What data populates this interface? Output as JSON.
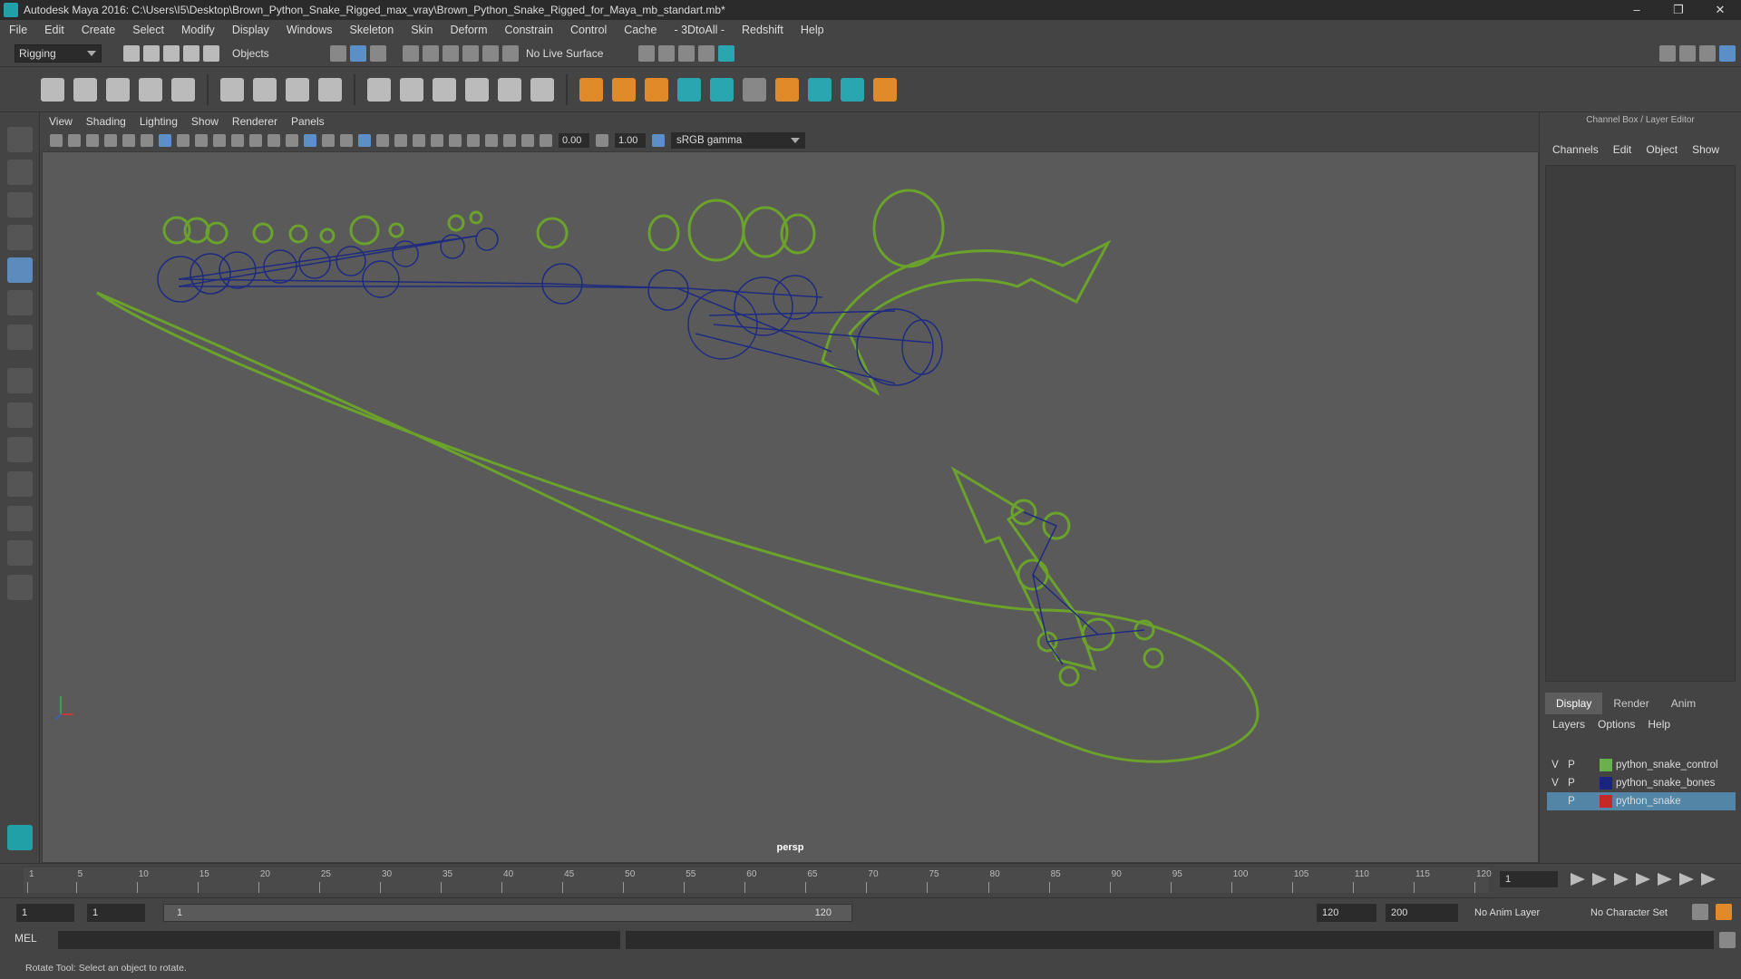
{
  "window": {
    "title": "Autodesk Maya 2016: C:\\Users\\I5\\Desktop\\Brown_Python_Snake_Rigged_max_vray\\Brown_Python_Snake_Rigged_for_Maya_mb_standart.mb*"
  },
  "menubar": [
    "File",
    "Edit",
    "Create",
    "Select",
    "Modify",
    "Display",
    "Windows",
    "Skeleton",
    "Skin",
    "Deform",
    "Constrain",
    "Control",
    "Cache",
    "- 3DtoAll -",
    "Redshift",
    "Help"
  ],
  "status": {
    "menuset": "Rigging",
    "selection_mode": "Objects",
    "live_surface": "No Live Surface"
  },
  "viewport": {
    "menu": [
      "View",
      "Shading",
      "Lighting",
      "Show",
      "Renderer",
      "Panels"
    ],
    "exposure": "0.00",
    "gamma": "1.00",
    "color_space": "sRGB gamma",
    "camera_label": "persp"
  },
  "channel_box": {
    "title": "Channel Box / Layer Editor",
    "menu": [
      "Channels",
      "Edit",
      "Object",
      "Show"
    ],
    "tabs": [
      "Display",
      "Render",
      "Anim"
    ],
    "layer_menu": [
      "Layers",
      "Options",
      "Help"
    ],
    "layers": [
      {
        "v": "V",
        "p": "P",
        "name": "python_snake_control",
        "color": "#6ab04c"
      },
      {
        "v": "V",
        "p": "P",
        "name": "python_snake_bones",
        "color": "#1a237e"
      },
      {
        "v": "",
        "p": "P",
        "name": "python_snake",
        "color": "#c62828"
      }
    ]
  },
  "timeline": {
    "ticks": [
      "1",
      "5",
      "10",
      "15",
      "20",
      "25",
      "30",
      "35",
      "40",
      "45",
      "50",
      "55",
      "60",
      "65",
      "70",
      "75",
      "80",
      "85",
      "90",
      "95",
      "100",
      "105",
      "110",
      "115",
      "120"
    ],
    "current_frame": "1"
  },
  "range": {
    "start": "1",
    "playback_start": "1",
    "slider_start": "1",
    "slider_end": "120",
    "playback_end": "120",
    "end": "200",
    "anim_layer": "No Anim Layer",
    "character_set": "No Character Set"
  },
  "command": {
    "label": "MEL"
  },
  "help_line": "Rotate Tool: Select an object to rotate."
}
